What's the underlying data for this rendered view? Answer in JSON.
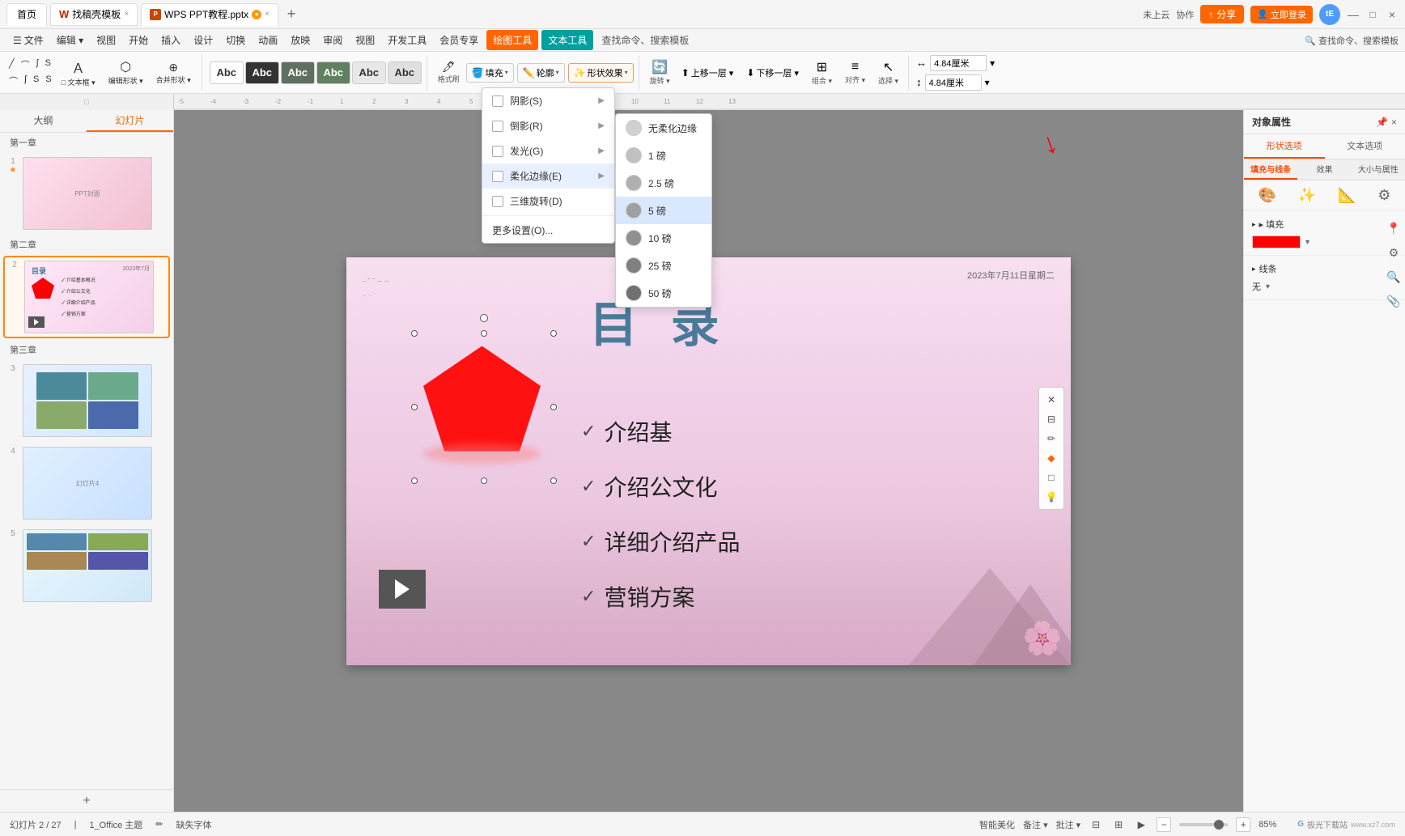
{
  "app": {
    "title": "WPS PPT教程.pptx",
    "tabs": [
      {
        "label": "首页",
        "active": false
      },
      {
        "label": "找稿壳模板",
        "active": false,
        "icon": "wps"
      },
      {
        "label": "WPS PPT教程.pptx",
        "active": true
      }
    ]
  },
  "menubar": {
    "items": [
      "文件",
      "编辑▾",
      "视图",
      "开始",
      "插入",
      "设计",
      "切换",
      "动画",
      "放映",
      "审阅",
      "视图",
      "开发工具",
      "会员专享",
      "绘图工具",
      "文本工具"
    ]
  },
  "toolbar": {
    "shape_styles": [
      "Abc",
      "Abc",
      "Abc",
      "Abc",
      "Abc",
      "Abc"
    ],
    "fill_label": "填充▾",
    "outline_label": "轮廓▾",
    "effect_label": "形状效果▾",
    "rotate_label": "旋转▾",
    "group_label": "组合▾",
    "align_label": "对齐▾",
    "layering_up": "上移一层▾",
    "layering_down": "下移一层▾",
    "select_label": "选择▾",
    "width_value": "4.84厘米",
    "height_value": "4.84厘米"
  },
  "shape_effect_menu": {
    "items": [
      {
        "label": "阴影(S)",
        "has_submenu": true
      },
      {
        "label": "倒影(R)",
        "has_submenu": true
      },
      {
        "label": "发光(G)",
        "has_submenu": true
      },
      {
        "label": "柔化边缘(E)",
        "has_submenu": true,
        "active": true
      },
      {
        "label": "三维旋转(D)",
        "has_submenu": false
      },
      {
        "label": "更多设置(O)...",
        "has_submenu": false
      }
    ]
  },
  "softedge_submenu": {
    "items": [
      {
        "label": "无柔化边缘",
        "value": 0
      },
      {
        "label": "1 磅",
        "value": 1
      },
      {
        "label": "2.5 磅",
        "value": 2.5
      },
      {
        "label": "5 磅",
        "value": 5,
        "active": true
      },
      {
        "label": "10 磅",
        "value": 10
      },
      {
        "label": "25 磅",
        "value": 25
      },
      {
        "label": "50 磅",
        "value": 50
      }
    ]
  },
  "right_panel": {
    "title": "对象属性",
    "tabs": [
      "形状选项",
      "文本选项"
    ],
    "sub_tabs": [
      "填充与线条",
      "效果",
      "大小与属性"
    ],
    "sections": [
      {
        "label": "▸ 填充",
        "color": "#ff0000"
      },
      {
        "label": "▸ 线条",
        "value": "无"
      }
    ]
  },
  "sidebar": {
    "tabs": [
      "大纲",
      "幻灯片"
    ],
    "chapters": [
      "第一章",
      "第二章",
      "第三章"
    ],
    "slides": [
      {
        "number": "1",
        "starred": true
      },
      {
        "number": "2",
        "starred": false,
        "active": true
      },
      {
        "number": "3",
        "starred": false
      },
      {
        "number": "4",
        "starred": false
      },
      {
        "number": "5",
        "starred": false
      }
    ]
  },
  "slide": {
    "date": "2023年7月11日星期二",
    "title": "目 录",
    "items": [
      "✓ 介绍基本概况",
      "✓ 介绍公文化",
      "✓ 详细介绍产品",
      "✓ 营销方案"
    ]
  },
  "status_bar": {
    "slide_info": "幻灯片 2 / 27",
    "theme": "1_Office 主题",
    "font_missing": "缺失字体",
    "ai_label": "智能美化",
    "备注": "备注 ▾",
    "批注": "批注 ▾",
    "zoom": "85%"
  },
  "top_right": {
    "cloud": "未上云",
    "collab": "协作",
    "share": "分享",
    "user_initials": "tE"
  },
  "colors": {
    "accent_orange": "#ff6600",
    "accent_blue": "#4d9cff",
    "accent_teal": "#00b0b0",
    "drawing_tool_bg": "#ff6600",
    "text_tool_bg": "#00b0b0",
    "fill_color": "#ff0000",
    "shape_color": "#ff1111"
  }
}
